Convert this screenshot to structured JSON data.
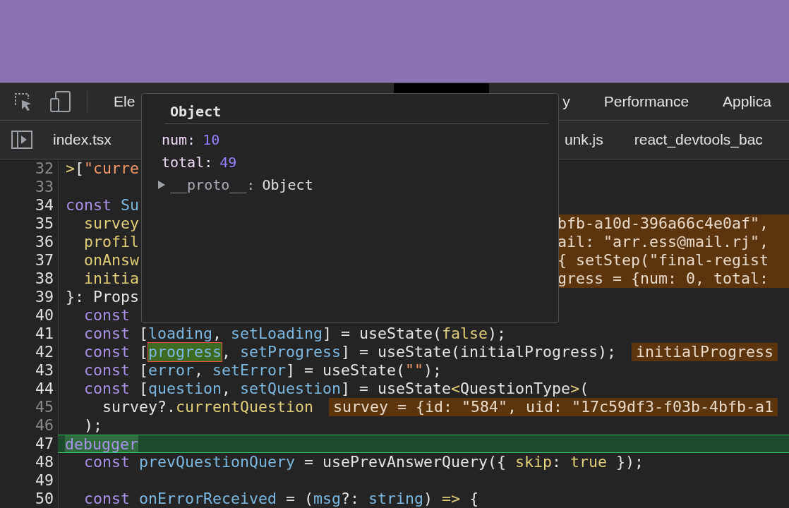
{
  "toolbar": {
    "tabs": [
      {
        "label": "Ele"
      },
      {
        "label": "y"
      },
      {
        "label": "Performance"
      },
      {
        "label": "Applica"
      }
    ]
  },
  "file_tabs": [
    {
      "label": "index.tsx"
    },
    {
      "label": "unk.js"
    },
    {
      "label": "react_devtools_bac"
    }
  ],
  "code": {
    "lines": [
      {
        "number": "32",
        "breakable": false,
        "paused": false,
        "tokens": [
          {
            "text": ">",
            "kind": "punct"
          },
          {
            "text": "[",
            "kind": "plain"
          },
          {
            "text": "\"curre",
            "kind": "str"
          }
        ]
      },
      {
        "number": "33",
        "breakable": false,
        "paused": false
      },
      {
        "number": "34",
        "breakable": true,
        "paused": false,
        "tokens": [
          {
            "text": "const",
            "kind": "kw"
          },
          {
            "text": " Su",
            "kind": "def"
          }
        ]
      },
      {
        "number": "35",
        "breakable": true,
        "paused": false,
        "tokens": [
          {
            "text": "  survey",
            "kind": "prop"
          }
        ],
        "value": {
          "text": "bfb-a10d-396a66c4e0af\",",
          "covered": true
        }
      },
      {
        "number": "36",
        "breakable": true,
        "paused": false,
        "tokens": [
          {
            "text": "  profil",
            "kind": "prop"
          }
        ],
        "value": {
          "text": "ail: \"arr.ess@mail.rj\",",
          "covered": true
        }
      },
      {
        "number": "37",
        "breakable": true,
        "paused": false,
        "tokens": [
          {
            "text": "  onAnsw",
            "kind": "prop"
          }
        ],
        "value": {
          "text": "{ setStep(\"final-regist",
          "covered": true
        }
      },
      {
        "number": "38",
        "breakable": true,
        "paused": false,
        "tokens": [
          {
            "text": "  initia",
            "kind": "prop"
          }
        ],
        "value": {
          "text": "gress = {num: 0, total:",
          "covered": true
        }
      },
      {
        "number": "39",
        "breakable": true,
        "paused": false,
        "tokens": [
          {
            "text": "}: Props",
            "kind": "plain"
          }
        ]
      },
      {
        "number": "40",
        "breakable": true,
        "paused": false,
        "tokens": [
          {
            "text": "  const",
            "kind": "kw"
          }
        ]
      },
      {
        "number": "41",
        "breakable": true,
        "paused": false,
        "tokens": [
          {
            "text": "  const",
            "kind": "kw"
          },
          {
            "text": " [",
            "kind": "plain"
          },
          {
            "text": "loading",
            "kind": "def"
          },
          {
            "text": ", ",
            "kind": "plain"
          },
          {
            "text": "setLoading",
            "kind": "def"
          },
          {
            "text": "] = useState(",
            "kind": "plain"
          },
          {
            "text": "false",
            "kind": "lit"
          },
          {
            "text": ");",
            "kind": "plain"
          }
        ]
      },
      {
        "number": "42",
        "breakable": true,
        "paused": false,
        "tokens": [
          {
            "text": "  const",
            "kind": "kw"
          },
          {
            "text": " [",
            "kind": "plain"
          },
          {
            "text": "progress",
            "kind": "hover"
          },
          {
            "text": ", ",
            "kind": "plain"
          },
          {
            "text": "setProgress",
            "kind": "def"
          },
          {
            "text": "] = useState(initialProgress);",
            "kind": "plain"
          }
        ],
        "value": {
          "text": "initialProgress",
          "covered": false
        }
      },
      {
        "number": "43",
        "breakable": true,
        "paused": false,
        "tokens": [
          {
            "text": "  const",
            "kind": "kw"
          },
          {
            "text": " [",
            "kind": "plain"
          },
          {
            "text": "error",
            "kind": "def"
          },
          {
            "text": ", ",
            "kind": "plain"
          },
          {
            "text": "setError",
            "kind": "def"
          },
          {
            "text": "] = useState(",
            "kind": "plain"
          },
          {
            "text": "\"\"",
            "kind": "str"
          },
          {
            "text": ");",
            "kind": "plain"
          }
        ]
      },
      {
        "number": "44",
        "breakable": true,
        "paused": false,
        "tokens": [
          {
            "text": "  const",
            "kind": "kw"
          },
          {
            "text": " [",
            "kind": "plain"
          },
          {
            "text": "question",
            "kind": "def"
          },
          {
            "text": ", ",
            "kind": "plain"
          },
          {
            "text": "setQuestion",
            "kind": "def"
          },
          {
            "text": "] = useState",
            "kind": "plain"
          },
          {
            "text": "<",
            "kind": "punct"
          },
          {
            "text": "QuestionType",
            "kind": "plain"
          },
          {
            "text": ">",
            "kind": "punct"
          },
          {
            "text": "(",
            "kind": "plain"
          }
        ]
      },
      {
        "number": "45",
        "breakable": false,
        "paused": false,
        "tokens": [
          {
            "text": "    survey?.",
            "kind": "plain"
          },
          {
            "text": "currentQuestion",
            "kind": "prop"
          }
        ],
        "value": {
          "text": "survey = {id: \"584\", uid: \"17c59df3-f03b-4bfb-a1",
          "covered": false
        }
      },
      {
        "number": "46",
        "breakable": false,
        "paused": false,
        "tokens": [
          {
            "text": "  );",
            "kind": "plain"
          }
        ]
      },
      {
        "number": "47",
        "breakable": true,
        "paused": true,
        "tokens": [
          {
            "text": "debugger",
            "kind": "exec"
          }
        ]
      },
      {
        "number": "48",
        "breakable": true,
        "paused": false,
        "tokens": [
          {
            "text": "  const",
            "kind": "kw"
          },
          {
            "text": " prevQuestionQuery",
            "kind": "def"
          },
          {
            "text": " = usePrevAnswerQuery({ ",
            "kind": "plain"
          },
          {
            "text": "skip",
            "kind": "prop"
          },
          {
            "text": ": ",
            "kind": "plain"
          },
          {
            "text": "true",
            "kind": "lit"
          },
          {
            "text": " });",
            "kind": "plain"
          }
        ]
      },
      {
        "number": "49",
        "breakable": true,
        "paused": false
      },
      {
        "number": "50",
        "breakable": true,
        "paused": false,
        "tokens": [
          {
            "text": "  const",
            "kind": "kw"
          },
          {
            "text": " onErrorReceived",
            "kind": "def"
          },
          {
            "text": " = (",
            "kind": "plain"
          },
          {
            "text": "msg",
            "kind": "def"
          },
          {
            "text": "?: ",
            "kind": "plain"
          },
          {
            "text": "string",
            "kind": "def"
          },
          {
            "text": ") ",
            "kind": "plain"
          },
          {
            "text": "=>",
            "kind": "punct"
          },
          {
            "text": " {",
            "kind": "plain"
          }
        ]
      }
    ]
  },
  "popover": {
    "title": "Object",
    "properties": [
      {
        "key": "num:",
        "value": "10"
      },
      {
        "key": "total:",
        "value": "49"
      }
    ],
    "prototype": {
      "key": "__proto__:",
      "value": "Object",
      "expanded": false
    }
  }
}
